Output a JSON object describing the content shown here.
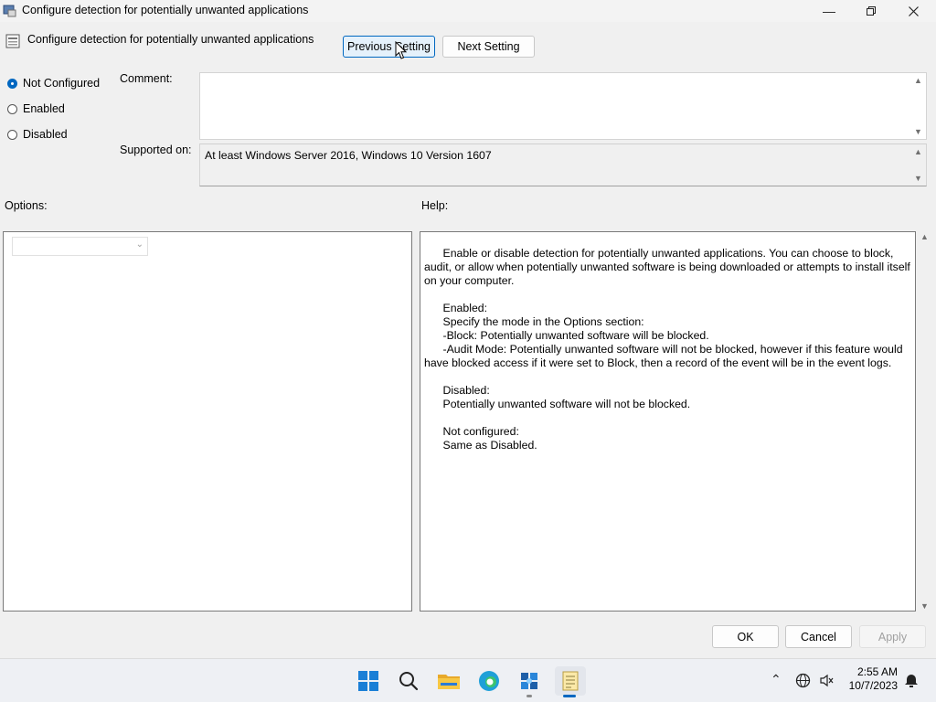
{
  "window": {
    "title": "Configure detection for potentially unwanted applications",
    "header_title": "Configure detection for potentially unwanted applications"
  },
  "nav": {
    "previous_label": "Previous Setting",
    "next_label": "Next Setting"
  },
  "state": {
    "options": [
      {
        "label": "Not Configured",
        "checked": true
      },
      {
        "label": "Enabled",
        "checked": false
      },
      {
        "label": "Disabled",
        "checked": false
      }
    ]
  },
  "labels": {
    "comment": "Comment:",
    "supported_on": "Supported on:",
    "options": "Options:",
    "help": "Help:"
  },
  "supported_on_value": "At least Windows Server 2016, Windows 10 Version 1607",
  "comment_value": "",
  "help_text": "      Enable or disable detection for potentially unwanted applications. You can choose to block, audit, or allow when potentially unwanted software is being downloaded or attempts to install itself on your computer.\n\n      Enabled:\n      Specify the mode in the Options section:\n      -Block: Potentially unwanted software will be blocked.\n      -Audit Mode: Potentially unwanted software will not be blocked, however if this feature would have blocked access if it were set to Block, then a record of the event will be in the event logs.\n\n      Disabled:\n      Potentially unwanted software will not be blocked.\n\n      Not configured:\n      Same as Disabled.",
  "footer": {
    "ok_label": "OK",
    "cancel_label": "Cancel",
    "apply_label": "Apply"
  },
  "taskbar": {
    "time": "2:55 AM",
    "date": "10/7/2023",
    "icons": [
      "windows-start-icon",
      "search-icon",
      "file-explorer-icon",
      "edge-icon",
      "network-app-icon",
      "notepad-icon"
    ]
  },
  "colors": {
    "accent": "#0067c0",
    "window_bg": "#f0f0f0"
  }
}
